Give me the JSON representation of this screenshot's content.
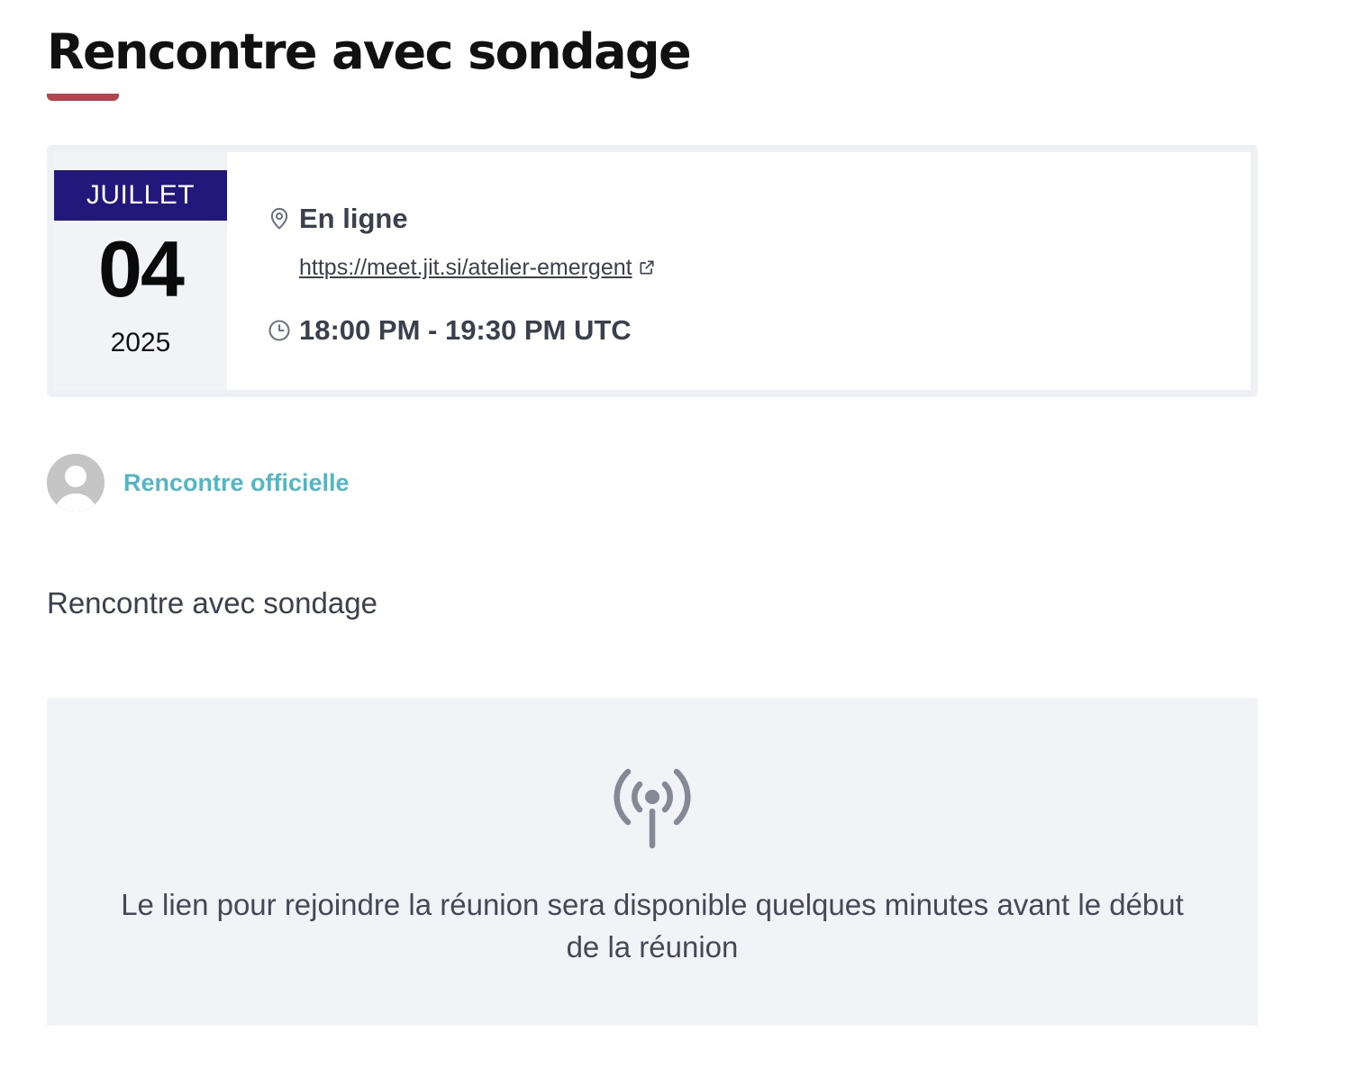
{
  "page": {
    "title": "Rencontre avec sondage",
    "accent_color": "#b4454f"
  },
  "event": {
    "date": {
      "month": "JUILLET",
      "day": "04",
      "year": "2025",
      "month_bg_color": "#22177a"
    },
    "location": {
      "icon": "map-pin-icon",
      "label": "En ligne",
      "url": "https://meet.jit.si/atelier-emergent",
      "link_text": "https://meet.jit.si/atelier-emergent",
      "external_icon": "external-link-icon"
    },
    "time": {
      "icon": "clock-icon",
      "label": "18:00 PM - 19:30 PM UTC"
    }
  },
  "organizer": {
    "avatar_icon": "default-user-avatar",
    "name": "Rencontre officielle",
    "color": "#52b7c4"
  },
  "description": "Rencontre avec sondage",
  "join_panel": {
    "icon": "broadcast-icon",
    "message": "Le lien pour rejoindre la réunion sera disponible quelques minutes avant le début de la réunion"
  }
}
